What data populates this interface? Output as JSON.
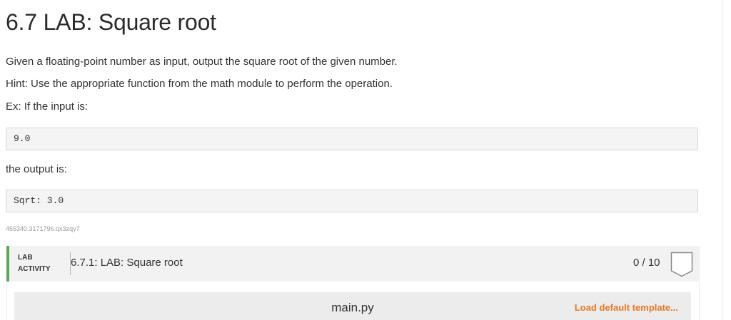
{
  "page": {
    "title": "6.7 LAB: Square root",
    "description": "Given a floating-point number as input, output the square root of the given number.",
    "hint": "Hint: Use the appropriate function from the math module to perform the operation.",
    "example_intro": "Ex: If the input is:",
    "example_input": "9.0",
    "output_intro": "the output is:",
    "example_output": "Sqrt: 3.0",
    "hash_id": "455340.3171796.qx3zqy7"
  },
  "lab": {
    "tag_line1": "LAB",
    "tag_line2": "ACTIVITY",
    "title": "6.7.1: LAB: Square root",
    "score": "0 / 10",
    "badge_icon": "completion-badge-icon",
    "accent_color": "#5aa85a"
  },
  "editor": {
    "file_name": "main.py",
    "load_template_label": "Load default template...",
    "link_color": "#e87722"
  }
}
